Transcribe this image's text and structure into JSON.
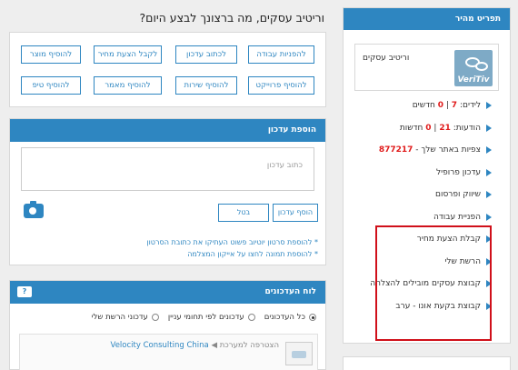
{
  "sidebar": {
    "header": "תפריט מהיר",
    "profile": {
      "name": "וריטיב עסקים",
      "logo_text": "VeriTiv"
    },
    "items": [
      {
        "prefix": "לידים:",
        "n1": "7",
        "sep": "|",
        "n2": "0",
        "suffix": "חדשים"
      },
      {
        "prefix": "הודעות:",
        "n1": "21",
        "sep": "|",
        "n2": "0",
        "suffix": "חדשות"
      },
      {
        "label": "צפיות באתר שלך -",
        "count": "877217"
      },
      {
        "label": "עדכון פרופיל"
      },
      {
        "label": "שיווק ופרסום"
      },
      {
        "label": "הפניית עבודה"
      },
      {
        "label": "קבלת הצעת מחיר"
      },
      {
        "label": "הרשת שלי"
      },
      {
        "label": "קבוצת עסקים מובילים להצלחה"
      },
      {
        "label": "קבוצת בקעת אונו - ערב"
      }
    ]
  },
  "main": {
    "title": "וריטיב עסקים, מה ברצונך לבצע היום?",
    "actions_row1": [
      "להפניות עבודה",
      "לכתוב עדכון",
      "לקבל הצעת מחיר",
      "להוסיף מוצר"
    ],
    "actions_row2": [
      "להוסיף פרוייקט",
      "להוסיף שירות",
      "להוסיף מאמר",
      "להוסיף טיפ"
    ]
  },
  "add_update": {
    "header": "הוספת עדכון",
    "placeholder": "כתוב עדכון",
    "submit_label": "הוסף עדכון",
    "cancel_label": "בטל",
    "note1": "* להוספת סרטון יוטיוב פשוט העתיקו את כתובת הסרטון",
    "note2": "* להוספת תמונה לחצו על אייקון המצלמה"
  },
  "board": {
    "header": "לוח העדכונים",
    "help_label": "?",
    "filters": [
      "כל העדכונים",
      "עדכונים לפי תחומי עניין",
      "עדכוני הרשת שלי"
    ],
    "selected_filter": 0,
    "feed": [
      {
        "company": "Velocity Consulting China",
        "arrow": "◀",
        "action": "הצטרפה למערכת"
      }
    ]
  }
}
